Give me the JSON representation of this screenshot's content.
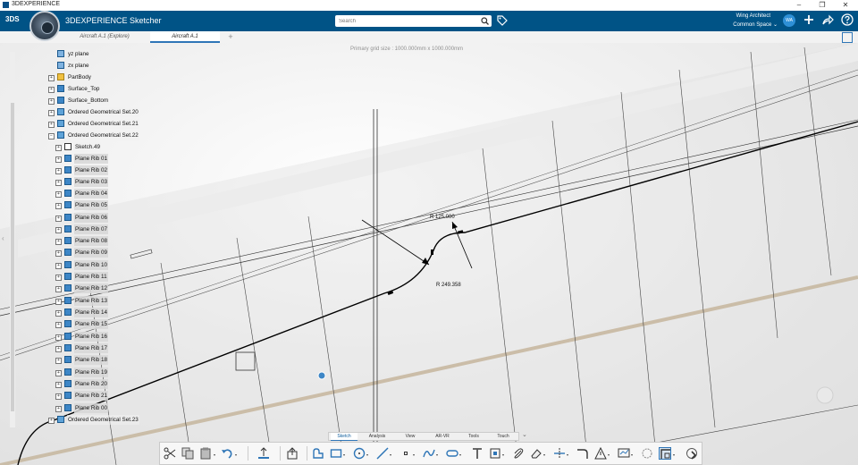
{
  "os": {
    "title": "3DEXPERIENCE",
    "minimize": "–",
    "maximize": "❐",
    "close": "✕"
  },
  "header": {
    "brand_logo": "3DS",
    "app_title": "3DEXPERIENCE Sketcher",
    "search_placeholder": "Search",
    "user_name": "Wing Architect",
    "user_space": "Common Space",
    "avatar_initials": "WA",
    "icons": [
      "tag-icon",
      "plus-icon",
      "share-icon",
      "help-icon"
    ]
  },
  "tabs": [
    {
      "label": "Aircraft A.1 (Explore)"
    },
    {
      "label": "Aircraft A.1"
    }
  ],
  "viewport": {
    "grid_info": "Primary grid size : 1000.000mm x 1000.000mm",
    "dimensions": [
      {
        "label": "R 125.000"
      },
      {
        "label": "R 249.358"
      }
    ]
  },
  "tree": {
    "items": [
      {
        "label": "yz plane",
        "icon": "plane-icon"
      },
      {
        "label": "zx plane",
        "icon": "plane-icon"
      },
      {
        "label": "PartBody",
        "icon": "body-icon"
      },
      {
        "label": "Surface_Top",
        "icon": "surface-icon"
      },
      {
        "label": "Surface_Bottom",
        "icon": "surface-icon"
      },
      {
        "label": "Ordered Geometrical Set.20",
        "icon": "geoset-icon"
      },
      {
        "label": "Ordered Geometrical Set.21",
        "icon": "geoset-icon"
      },
      {
        "label": "Ordered Geometrical Set.22",
        "icon": "geoset-icon"
      },
      {
        "label": "Sketch.49",
        "icon": "sketch-icon"
      },
      {
        "label": "Plane Rib 01",
        "icon": "plane-icon"
      },
      {
        "label": "Plane Rib 02",
        "icon": "plane-icon"
      },
      {
        "label": "Plane Rib 03",
        "icon": "plane-icon"
      },
      {
        "label": "Plane Rib 04",
        "icon": "plane-icon"
      },
      {
        "label": "Plane Rib 05",
        "icon": "plane-icon"
      },
      {
        "label": "Plane Rib 06",
        "icon": "plane-icon"
      },
      {
        "label": "Plane Rib 07",
        "icon": "plane-icon"
      },
      {
        "label": "Plane Rib 08",
        "icon": "plane-icon"
      },
      {
        "label": "Plane Rib 09",
        "icon": "plane-icon"
      },
      {
        "label": "Plane Rib 10",
        "icon": "plane-icon"
      },
      {
        "label": "Plane Rib 11",
        "icon": "plane-icon"
      },
      {
        "label": "Plane Rib 12",
        "icon": "plane-icon"
      },
      {
        "label": "Plane Rib 13",
        "icon": "plane-icon"
      },
      {
        "label": "Plane Rib 14",
        "icon": "plane-icon"
      },
      {
        "label": "Plane Rib 15",
        "icon": "plane-icon"
      },
      {
        "label": "Plane Rib 16",
        "icon": "plane-icon"
      },
      {
        "label": "Plane Rib 17",
        "icon": "plane-icon"
      },
      {
        "label": "Plane Rib 18",
        "icon": "plane-icon"
      },
      {
        "label": "Plane Rib 19",
        "icon": "plane-icon"
      },
      {
        "label": "Plane Rib 20",
        "icon": "plane-icon"
      },
      {
        "label": "Plane Rib 21",
        "icon": "plane-icon"
      },
      {
        "label": "Plane Rib 00",
        "icon": "plane-icon"
      },
      {
        "label": "Ordered Geometrical Set.23",
        "icon": "geoset-icon"
      }
    ]
  },
  "section_tabs": [
    "Sketch",
    "Analysis",
    "View",
    "AR-VR",
    "Tools",
    "Touch"
  ],
  "colors": {
    "header": "#005386",
    "accent": "#2f76b7",
    "wing_spar": "#c8b9a2"
  }
}
